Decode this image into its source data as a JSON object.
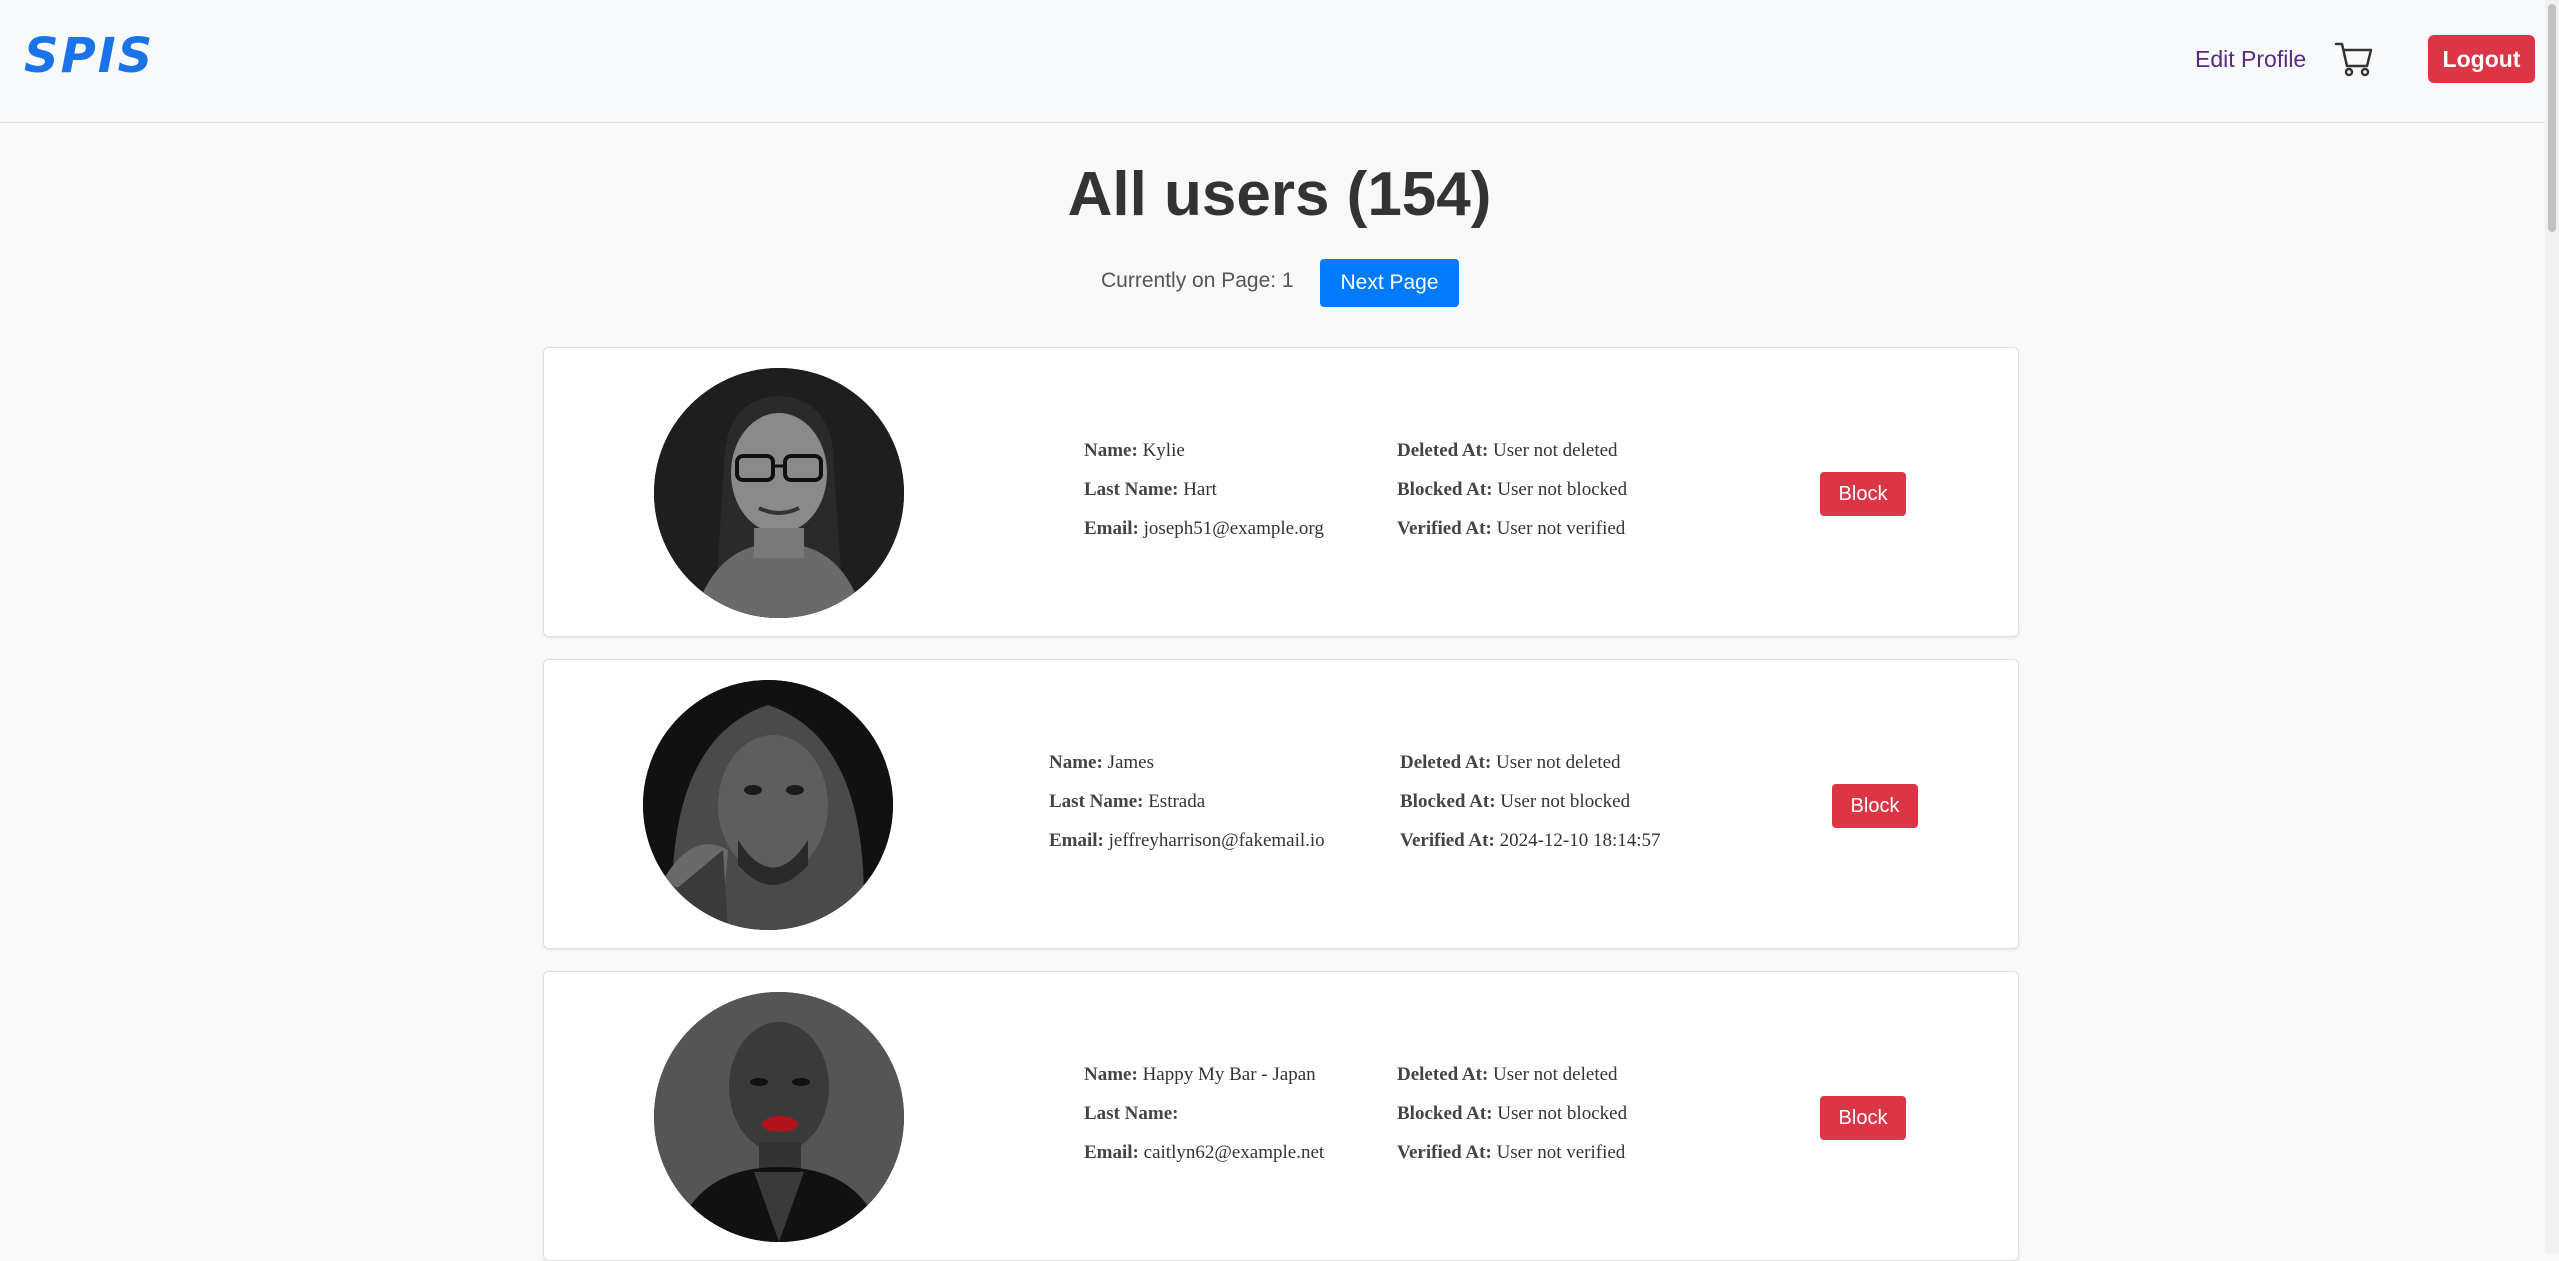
{
  "nav": {
    "logo": "SPIS",
    "edit_profile": "Edit Profile",
    "cart_icon": "cart-icon",
    "logout": "Logout"
  },
  "page": {
    "title": "All users (154)",
    "pager_text": "Currently on Page: 1",
    "next_page": "Next Page"
  },
  "labels": {
    "name": "Name:",
    "last_name": "Last Name:",
    "email": "Email:",
    "deleted_at": "Deleted At:",
    "blocked_at": "Blocked At:",
    "verified_at": "Verified At:"
  },
  "users": [
    {
      "name": "Kylie",
      "last_name": "Hart",
      "email": "joseph51@example.org",
      "deleted_at": "User not deleted",
      "blocked_at": "User not blocked",
      "verified_at": "User not verified",
      "action": "Block"
    },
    {
      "name": "James",
      "last_name": "Estrada",
      "email": "jeffreyharrison@fakemail.io",
      "deleted_at": "User not deleted",
      "blocked_at": "User not blocked",
      "verified_at": "2024-12-10 18:14:57",
      "action": "Block"
    },
    {
      "name": "Happy My Bar - Japan",
      "last_name": "",
      "email": "caitlyn62@example.net",
      "deleted_at": "User not deleted",
      "blocked_at": "User not blocked",
      "verified_at": "User not verified",
      "action": "Block"
    }
  ],
  "colors": {
    "logo": "#1a73e8",
    "primary": "#007bff",
    "danger": "#dc3545",
    "nav_link": "#5a2a82"
  }
}
